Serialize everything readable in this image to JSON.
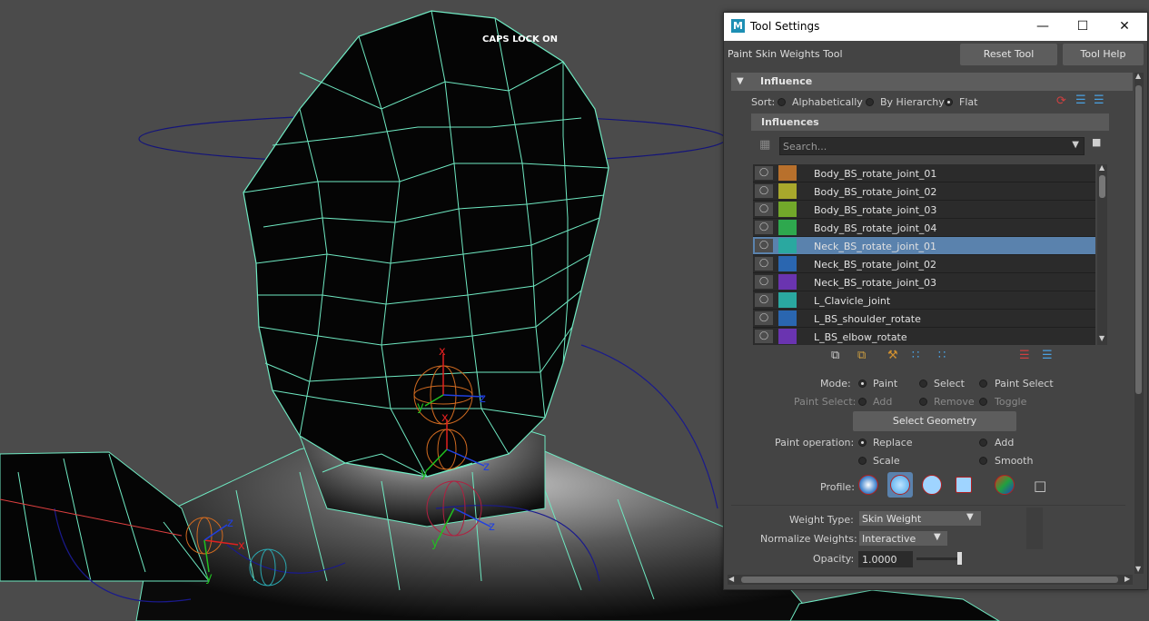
{
  "viewport": {
    "caps_lock": "CAPS LOCK ON",
    "axis_labels": [
      "x",
      "y",
      "z",
      "x",
      "y",
      "z",
      "x",
      "y",
      "z",
      "y",
      "z",
      "x",
      "y"
    ]
  },
  "window": {
    "app_icon": "M",
    "title": "Tool Settings",
    "tool_name": "Paint Skin Weights Tool",
    "reset_label": "Reset Tool",
    "help_label": "Tool Help"
  },
  "influence": {
    "header": "Influence",
    "sort_label": "Sort:",
    "sort_options": [
      "Alphabetically",
      "By Hierarchy",
      "Flat"
    ],
    "sort_selected": "Flat",
    "sub_header": "Influences",
    "search_placeholder": "Search...",
    "items": [
      {
        "name": "Body_BS_rotate_joint_01",
        "color": "#b8702c",
        "selected": false
      },
      {
        "name": "Body_BS_rotate_joint_02",
        "color": "#a8a82c",
        "selected": false
      },
      {
        "name": "Body_BS_rotate_joint_03",
        "color": "#72a82a",
        "selected": false
      },
      {
        "name": "Body_BS_rotate_joint_04",
        "color": "#2ea84e",
        "selected": false
      },
      {
        "name": "Neck_BS_rotate_joint_01",
        "color": "#2aa8a0",
        "selected": true
      },
      {
        "name": "Neck_BS_rotate_joint_02",
        "color": "#2a66b0",
        "selected": false
      },
      {
        "name": "Neck_BS_rotate_joint_03",
        "color": "#6a34b0",
        "selected": false
      },
      {
        "name": "L_Clavicle_joint",
        "color": "#2aa8a0",
        "selected": false
      },
      {
        "name": "L_BS_shoulder_rotate",
        "color": "#2a66b0",
        "selected": false
      },
      {
        "name": "L_BS_elbow_rotate",
        "color": "#6a34b0",
        "selected": false
      }
    ]
  },
  "mode": {
    "label": "Mode:",
    "options": [
      "Paint",
      "Select",
      "Paint Select"
    ],
    "selected": "Paint",
    "paint_select_label": "Paint Select:",
    "paint_select_options": [
      "Add",
      "Remove",
      "Toggle"
    ],
    "select_geometry": "Select Geometry"
  },
  "paint_operation": {
    "label": "Paint operation:",
    "options": [
      "Replace",
      "Add",
      "Scale",
      "Smooth"
    ],
    "selected": "Replace"
  },
  "profile": {
    "label": "Profile:",
    "selected_index": 1
  },
  "weights": {
    "weight_type_label": "Weight Type:",
    "weight_type": "Skin Weight",
    "normalize_label": "Normalize Weights:",
    "normalize": "Interactive",
    "opacity_label": "Opacity:",
    "opacity": "1.0000",
    "opacity_fraction": 0.9
  },
  "colors": {
    "panel_bg": "#444444",
    "selection": "#5a82ad",
    "wire": "#6fe9c2"
  }
}
